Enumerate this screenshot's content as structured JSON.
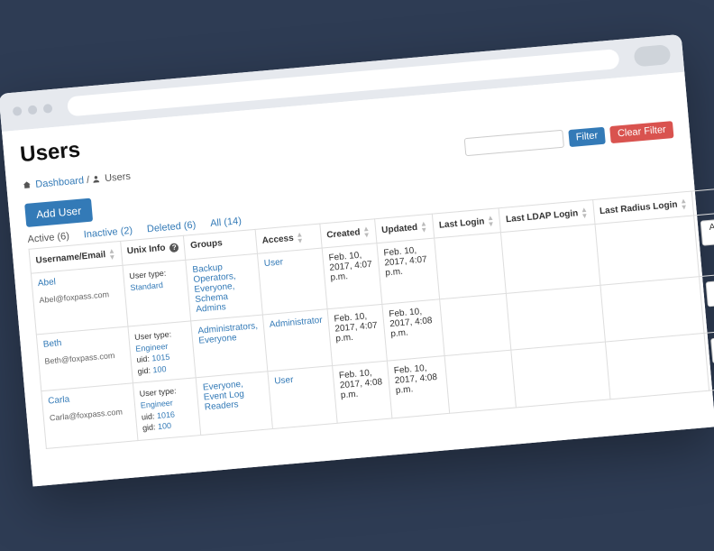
{
  "page_title": "Users",
  "breadcrumb": {
    "dashboard": "Dashboard",
    "users": "Users"
  },
  "buttons": {
    "filter": "Filter",
    "clear_filter": "Clear Filter",
    "add_user": "Add User",
    "actions": "Actions"
  },
  "tabs": [
    {
      "label": "Active (6)",
      "active": true
    },
    {
      "label": "Inactive (2)",
      "active": false
    },
    {
      "label": "Deleted (6)",
      "active": false
    },
    {
      "label": "All (14)",
      "active": false
    }
  ],
  "columns": {
    "username": "Username/Email",
    "unix": "Unix Info",
    "groups": "Groups",
    "access": "Access",
    "created": "Created",
    "updated": "Updated",
    "last_login": "Last Login",
    "last_ldap": "Last LDAP Login",
    "last_radius": "Last Radius Login"
  },
  "rows": [
    {
      "name": "Abel",
      "email": "Abel@foxpass.com",
      "unix_type_label": "User type:",
      "unix_type": "Standard",
      "uid": "",
      "gid": "",
      "groups": "Backup Operators, Everyone, Schema Admins",
      "access": "User",
      "created": "Feb. 10, 2017, 4:07 p.m.",
      "updated": "Feb. 10, 2017, 4:07 p.m.",
      "last_login": "",
      "last_ldap": "",
      "last_radius": ""
    },
    {
      "name": "Beth",
      "email": "Beth@foxpass.com",
      "unix_type_label": "User type:",
      "unix_type": "Engineer",
      "uid_label": "uid:",
      "uid": "1015",
      "gid_label": "gid:",
      "gid": "100",
      "groups": "Administrators, Everyone",
      "access": "Administrator",
      "created": "Feb. 10, 2017, 4:07 p.m.",
      "updated": "Feb. 10, 2017, 4:08 p.m.",
      "last_login": "",
      "last_ldap": "",
      "last_radius": ""
    },
    {
      "name": "Carla",
      "email": "Carla@foxpass.com",
      "unix_type_label": "User type:",
      "unix_type": "Engineer",
      "uid_label": "uid:",
      "uid": "1016",
      "gid_label": "gid:",
      "gid": "100",
      "groups": "Everyone, Event Log Readers",
      "access": "User",
      "created": "Feb. 10, 2017, 4:08 p.m.",
      "updated": "Feb. 10, 2017, 4:08 p.m.",
      "last_login": "",
      "last_ldap": "",
      "last_radius": ""
    }
  ]
}
